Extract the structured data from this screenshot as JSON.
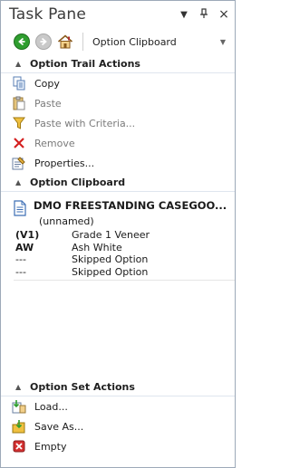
{
  "title": "Task Pane",
  "nav": {
    "selector_value": "Option Clipboard"
  },
  "sections": {
    "trail": {
      "header": "Option Trail Actions",
      "actions": [
        {
          "label": "Copy",
          "icon": "copy-icon"
        },
        {
          "label": "Paste",
          "icon": "paste-icon"
        },
        {
          "label": "Paste with Criteria...",
          "icon": "paste-criteria-icon"
        },
        {
          "label": "Remove",
          "icon": "remove-icon"
        },
        {
          "label": "Properties...",
          "icon": "properties-icon"
        }
      ]
    },
    "clipboard": {
      "header": "Option Clipboard",
      "item": {
        "name": "DMO FREESTANDING CASEGOO...",
        "sub": "(unnamed)",
        "options": [
          {
            "code": "(V1)",
            "desc": "Grade 1 Veneer"
          },
          {
            "code": "AW",
            "desc": "Ash White"
          },
          {
            "code": "---",
            "desc": "Skipped Option"
          },
          {
            "code": "---",
            "desc": "Skipped Option"
          }
        ]
      }
    },
    "set": {
      "header": "Option Set Actions",
      "actions": [
        {
          "label": "Load...",
          "icon": "load-icon"
        },
        {
          "label": "Save As...",
          "icon": "save-as-icon"
        },
        {
          "label": "Empty",
          "icon": "empty-icon"
        }
      ]
    }
  },
  "colors": {
    "nav_back": "#2f9e2f",
    "remove_red": "#d42020",
    "section_border": "#dfe6ee"
  }
}
